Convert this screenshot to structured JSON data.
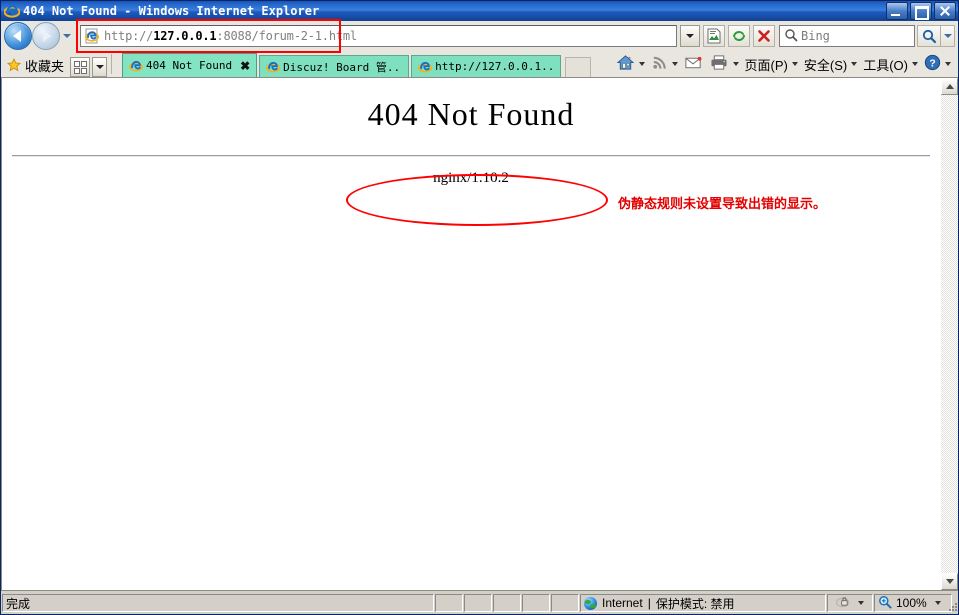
{
  "window": {
    "title": "404 Not Found - Windows Internet Explorer",
    "minimize_label": "Minimize",
    "maximize_label": "Maximize",
    "close_label": "Close"
  },
  "nav": {
    "back_label": "Back",
    "forward_label": "Forward",
    "history_label": "Recent Pages",
    "compat_label": "Compatibility View",
    "refresh_label": "Refresh",
    "stop_label": "Stop",
    "address_dropdown_label": "Address history"
  },
  "address": {
    "scheme": "http://",
    "host": "127.0.0.1",
    "rest": ":8088/forum-2-1.html",
    "full": "http://127.0.0.1:8088/forum-2-1.html"
  },
  "search": {
    "provider": "Bing",
    "placeholder": "Bing",
    "go_label": "Search",
    "dropdown_label": "Search provider"
  },
  "favorites": {
    "label": "收藏夹",
    "grid_label": "Favorites Bar",
    "dropdown_label": "Add to Favorites Bar"
  },
  "tabs": [
    {
      "label": "404 Not Found",
      "active": true,
      "closable": true
    },
    {
      "label": "Discuz! Board 管...",
      "active": false,
      "closable": false
    },
    {
      "label": "http://127.0.0.1...",
      "active": false,
      "closable": false
    }
  ],
  "newtab_label": "New Tab",
  "commandbar": {
    "home_label": "Home",
    "feeds_label": "Feeds",
    "mail_label": "Read Mail",
    "print_label": "Print",
    "items": [
      {
        "label": "页面(P)"
      },
      {
        "label": "安全(S)"
      },
      {
        "label": "工具(O)"
      }
    ],
    "help_label": "Help"
  },
  "page": {
    "heading": "404 Not Found",
    "server": "nginx/1.10.2",
    "annotation": "伪静态规则未设置导致出错的显示。",
    "annotation_color": "#e40000",
    "highlight_color": "#ff0000"
  },
  "scrollbar": {
    "up_label": "Scroll up",
    "down_label": "Scroll down",
    "track_label": "Scroll track"
  },
  "statusbar": {
    "status": "完成",
    "zone": "Internet",
    "zone_separator": "|",
    "protected_mode": "保护模式: 禁用",
    "security_label": "Privacy Report",
    "zoom": "100%",
    "resize_label": "Resize"
  }
}
